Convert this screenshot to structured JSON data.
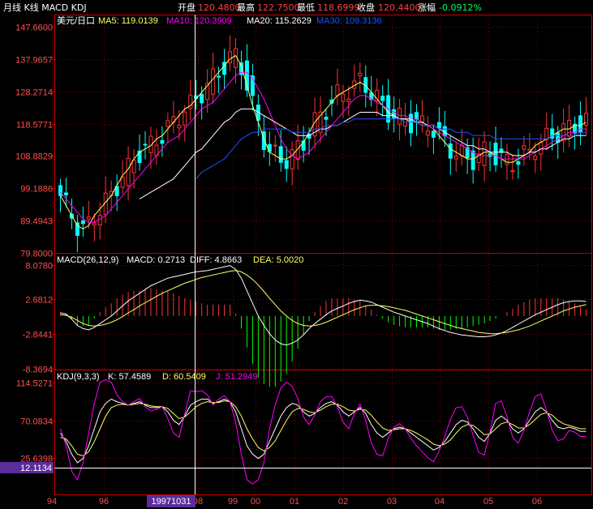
{
  "title": "月线 K线 MACD KDJ",
  "quote": {
    "open_label": "开盘",
    "open": "120.4800",
    "high_label": "最高",
    "high": "122.7500",
    "low_label": "最低",
    "low": "118.6999",
    "close_label": "收盘",
    "close": "120.4400",
    "change_label": "涨幅",
    "change": "-0.0912%"
  },
  "colors": {
    "up": "#ff3232",
    "down": "#00ffff",
    "ma5": "#ffff66",
    "ma10": "#ff00ff",
    "ma20": "#ffffff",
    "ma30": "#1e50ff",
    "axis": "#c80000",
    "grid": "#800000",
    "text_axis": "#ff5050",
    "highlight": "#ffff00",
    "crosshair": "#ffffff"
  },
  "main_legend": {
    "symbol": "美元/日口",
    "ma5": "MA5: 119.0139",
    "ma10": "MA10: 120.3909",
    "ma20": "MA20: 115.2629",
    "ma30": "MA30: 109.3136"
  },
  "macd_legend": {
    "name": "MACD(26,12,9)",
    "macd": "MACD: 0.2713",
    "diff": "DIFF: 4.8663",
    "dea": "DEA: 5.0020"
  },
  "kdj_legend": {
    "name": "KDJ(9,3,3)",
    "k": "K: 57.4589",
    "d": "D: 60.5409",
    "j": "J: 51.2949"
  },
  "cursor": {
    "date_label": "19971031",
    "kdj_value": "12.1134"
  },
  "chart_data": [
    {
      "panel": "price",
      "type": "candlestick",
      "y_ticks": [
        "147.6600",
        "137.9657",
        "128.2714",
        "118.5771",
        "108.8829",
        "99.1886",
        "89.4943",
        "79.8000"
      ],
      "ylim": [
        79.8,
        147.66
      ],
      "series": [
        {
          "name": "MA5",
          "values": [
            97,
            94,
            91,
            88,
            87,
            88,
            91,
            93,
            95,
            97,
            100,
            103,
            105,
            108,
            110,
            111,
            112,
            114,
            115,
            117,
            119,
            121,
            123,
            124,
            126,
            128,
            130,
            132,
            134,
            136,
            138,
            139,
            136,
            130,
            124,
            119,
            114,
            110,
            109,
            108,
            108,
            109,
            111,
            113,
            116,
            119,
            121,
            123,
            125,
            127,
            128,
            129,
            130,
            131,
            130,
            128,
            126,
            124,
            122,
            121,
            120,
            120,
            119,
            119,
            118,
            118,
            117,
            115,
            113,
            111,
            110,
            109,
            108,
            108,
            109,
            110,
            110,
            109,
            108,
            107,
            107,
            108,
            109,
            110,
            112,
            113,
            114,
            115,
            116,
            117,
            117,
            118,
            118,
            119
          ]
        },
        {
          "name": "MA10",
          "values": [
            98,
            96,
            94,
            92,
            90,
            89,
            89,
            90,
            91,
            93,
            95,
            97,
            99,
            101,
            103,
            105,
            107,
            109,
            111,
            113,
            114,
            115,
            117,
            119,
            121,
            123,
            124,
            125,
            127,
            129,
            131,
            133,
            134,
            134,
            132,
            129,
            126,
            122,
            118,
            114,
            111,
            109,
            108,
            109,
            110,
            112,
            114,
            116,
            118,
            120,
            122,
            124,
            126,
            127,
            127,
            126,
            125,
            124,
            123,
            122,
            121,
            121,
            120,
            120,
            119,
            118,
            117,
            116,
            115,
            114,
            113,
            112,
            111,
            110,
            109,
            109,
            109,
            109,
            108,
            108,
            108,
            108,
            108,
            109,
            110,
            111,
            112,
            113,
            114,
            115,
            116,
            116,
            117,
            117
          ]
        },
        {
          "name": "MA20",
          "values": [
            null,
            null,
            null,
            null,
            null,
            null,
            null,
            null,
            null,
            null,
            null,
            null,
            null,
            null,
            96,
            97,
            98,
            99,
            100,
            101,
            102,
            104,
            106,
            108,
            110,
            111,
            113,
            115,
            117,
            119,
            120,
            122,
            123,
            123,
            123,
            122,
            121,
            120,
            119,
            118,
            117,
            116,
            115,
            115,
            115,
            116,
            117,
            117,
            118,
            118,
            119,
            120,
            121,
            122,
            122,
            122,
            122,
            121,
            121,
            121,
            120,
            120,
            120,
            119,
            119,
            118,
            118,
            117,
            116,
            115,
            114,
            113,
            112,
            112,
            111,
            111,
            110,
            110,
            110,
            110,
            109,
            109,
            109,
            110,
            110,
            111,
            111,
            112,
            113,
            114,
            114,
            115,
            115,
            115
          ]
        },
        {
          "name": "MA30",
          "values": [
            null,
            null,
            null,
            null,
            null,
            null,
            null,
            null,
            null,
            null,
            null,
            null,
            null,
            null,
            null,
            null,
            null,
            null,
            null,
            null,
            null,
            null,
            null,
            null,
            102,
            104,
            105,
            106,
            107,
            108,
            110,
            112,
            114,
            115,
            116,
            116,
            117,
            117,
            117,
            117,
            117,
            116,
            116,
            116,
            116,
            117,
            117,
            118,
            118,
            118,
            119,
            119,
            120,
            120,
            120,
            120,
            120,
            120,
            120,
            120,
            120,
            119,
            119,
            119,
            118,
            118,
            118,
            117,
            117,
            117,
            116,
            116,
            116,
            115,
            115,
            115,
            115,
            114,
            114,
            114,
            114,
            114,
            114,
            114,
            114,
            114,
            114,
            115,
            115,
            115,
            115,
            115,
            116,
            116
          ]
        }
      ]
    },
    {
      "panel": "macd",
      "type": "line+bar",
      "y_ticks": [
        "8.0780",
        "2.6812",
        "-2.8441",
        "-8.3694"
      ],
      "ylim": [
        -8.3694,
        8.078
      ],
      "series": [
        {
          "name": "DIFF",
          "values": [
            0.5,
            0.3,
            -0.5,
            -1.5,
            -2,
            -2.2,
            -1.8,
            -1.2,
            -0.6,
            0,
            0.8,
            1.6,
            2.4,
            3,
            3.6,
            4.2,
            4.8,
            5.2,
            5.6,
            6,
            6.2,
            6.4,
            6.6,
            6.8,
            7,
            7.1,
            7.2,
            7.4,
            7.6,
            7.8,
            8,
            7.4,
            6,
            4,
            2,
            0,
            -1.5,
            -2.8,
            -3.8,
            -4.4,
            -4.6,
            -4.3,
            -3.8,
            -3,
            -2,
            -1.2,
            -0.5,
            0.2,
            0.8,
            1.2,
            1.6,
            2,
            2.3,
            2.5,
            2.4,
            2.2,
            1.8,
            1.4,
            1,
            0.6,
            0.3,
            0,
            -0.3,
            -0.6,
            -0.9,
            -1.2,
            -1.6,
            -2,
            -2.3,
            -2.6,
            -2.8,
            -3,
            -3.1,
            -3.2,
            -3.3,
            -3.3,
            -3.2,
            -3,
            -2.7,
            -2.3,
            -1.8,
            -1.3,
            -0.8,
            -0.3,
            0.2,
            0.6,
            1,
            1.4,
            1.8,
            2.1,
            2.3,
            2.4,
            2.4,
            2.3
          ]
        },
        {
          "name": "DEA",
          "values": [
            0.2,
            0.1,
            -0.2,
            -0.7,
            -1.2,
            -1.5,
            -1.6,
            -1.5,
            -1.3,
            -1,
            -0.6,
            -0.1,
            0.5,
            1,
            1.6,
            2.1,
            2.6,
            3.1,
            3.6,
            4,
            4.4,
            4.8,
            5.2,
            5.5,
            5.8,
            6.1,
            6.3,
            6.5,
            6.7,
            6.9,
            7.1,
            7.2,
            7,
            6.5,
            5.8,
            4.9,
            3.9,
            2.8,
            1.8,
            0.8,
            0,
            -0.7,
            -1.2,
            -1.5,
            -1.6,
            -1.5,
            -1.3,
            -1,
            -0.6,
            -0.2,
            0.2,
            0.6,
            1,
            1.3,
            1.6,
            1.7,
            1.7,
            1.6,
            1.5,
            1.3,
            1.1,
            0.9,
            0.6,
            0.3,
            0,
            -0.3,
            -0.6,
            -0.9,
            -1.2,
            -1.5,
            -1.8,
            -2,
            -2.2,
            -2.4,
            -2.6,
            -2.7,
            -2.8,
            -2.8,
            -2.7,
            -2.6,
            -2.4,
            -2.2,
            -1.9,
            -1.6,
            -1.2,
            -0.8,
            -0.4,
            0,
            0.4,
            0.8,
            1.1,
            1.4,
            1.6,
            1.8
          ]
        }
      ]
    },
    {
      "panel": "kdj",
      "type": "line",
      "y_ticks": [
        "114.5271",
        "70.0834",
        "25.6398"
      ],
      "ylim": [
        -10,
        125
      ],
      "series": [
        {
          "name": "K",
          "values": [
            55,
            45,
            30,
            20,
            25,
            40,
            60,
            80,
            90,
            95,
            92,
            90,
            88,
            90,
            92,
            88,
            85,
            85,
            86,
            80,
            70,
            65,
            75,
            88,
            92,
            95,
            95,
            90,
            92,
            95,
            92,
            80,
            60,
            40,
            30,
            25,
            30,
            45,
            60,
            75,
            85,
            90,
            88,
            80,
            75,
            78,
            85,
            90,
            92,
            88,
            80,
            75,
            80,
            85,
            78,
            65,
            55,
            50,
            55,
            60,
            62,
            60,
            55,
            50,
            45,
            40,
            35,
            38,
            45,
            55,
            65,
            70,
            68,
            60,
            50,
            45,
            55,
            70,
            75,
            70,
            60,
            55,
            60,
            70,
            80,
            85,
            80,
            70,
            62,
            60,
            62,
            60,
            57,
            57
          ]
        },
        {
          "name": "D",
          "values": [
            50,
            48,
            40,
            30,
            28,
            33,
            45,
            60,
            75,
            85,
            88,
            89,
            88,
            89,
            90,
            89,
            87,
            86,
            86,
            84,
            78,
            72,
            74,
            80,
            86,
            90,
            92,
            91,
            91,
            93,
            92,
            86,
            75,
            60,
            48,
            38,
            34,
            38,
            46,
            58,
            70,
            80,
            84,
            83,
            80,
            79,
            82,
            86,
            89,
            89,
            86,
            82,
            81,
            83,
            82,
            76,
            68,
            61,
            58,
            59,
            60,
            60,
            58,
            55,
            51,
            47,
            42,
            40,
            42,
            47,
            55,
            62,
            65,
            64,
            59,
            53,
            54,
            60,
            66,
            68,
            65,
            61,
            61,
            65,
            71,
            77,
            79,
            76,
            70,
            66,
            64,
            62,
            60,
            60
          ]
        },
        {
          "name": "J",
          "values": [
            60,
            40,
            10,
            0,
            20,
            55,
            90,
            115,
            118,
            115,
            100,
            92,
            88,
            92,
            96,
            86,
            81,
            83,
            86,
            72,
            55,
            50,
            78,
            105,
            104,
            105,
            100,
            88,
            95,
            99,
            92,
            68,
            30,
            0,
            -5,
            0,
            20,
            60,
            88,
            108,
            115,
            110,
            96,
            74,
            65,
            76,
            92,
            98,
            98,
            86,
            68,
            60,
            78,
            89,
            70,
            43,
            30,
            28,
            49,
            62,
            66,
            60,
            49,
            40,
            33,
            26,
            21,
            34,
            51,
            71,
            85,
            86,
            74,
            52,
            32,
            29,
            57,
            90,
            93,
            74,
            50,
            43,
            58,
            80,
            98,
            101,
            82,
            58,
            46,
            48,
            58,
            56,
            51,
            51
          ]
        }
      ]
    }
  ],
  "x_axis_labels": [
    "94",
    "96",
    "98",
    "99",
    "00",
    "01",
    "02",
    "03",
    "04",
    "05",
    "06"
  ]
}
